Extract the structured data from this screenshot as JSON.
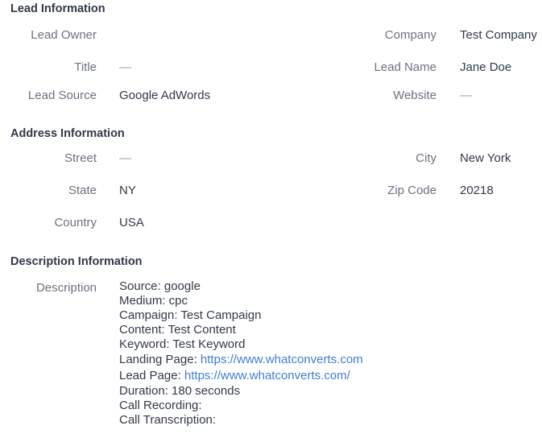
{
  "sections": {
    "lead_info_title": "Lead Information",
    "address_info_title": "Address Information",
    "description_info_title": "Description Information"
  },
  "lead": {
    "owner_label": "Lead Owner",
    "owner_value": "",
    "company_label": "Company",
    "company_value": "Test Company",
    "title_label": "Title",
    "title_value": "—",
    "name_label": "Lead Name",
    "name_value": "Jane Doe",
    "source_label": "Lead Source",
    "source_value": "Google AdWords",
    "website_label": "Website",
    "website_value": "—"
  },
  "address": {
    "street_label": "Street",
    "street_value": "—",
    "city_label": "City",
    "city_value": "New York",
    "state_label": "State",
    "state_value": "NY",
    "zip_label": "Zip Code",
    "zip_value": "20218",
    "country_label": "Country",
    "country_value": "USA"
  },
  "description": {
    "label": "Description",
    "source": "Source: google",
    "medium": "Medium: cpc",
    "campaign": "Campaign: Test Campaign",
    "content": "Content: Test Content",
    "keyword": "Keyword: Test Keyword",
    "landing_page_prefix": "Landing Page: ",
    "landing_page_url": "https://www.whatconverts.com",
    "lead_page_prefix": "Lead Page: ",
    "lead_page_url": "https://www.whatconverts.com/",
    "duration": "Duration: 180 seconds",
    "call_recording": "Call Recording:",
    "call_transcription": "Call Transcription:"
  },
  "colors": {
    "text": "#313949",
    "label": "#6b7280",
    "link": "#3f7fd1",
    "empty_dash": "#9aa0aa"
  }
}
